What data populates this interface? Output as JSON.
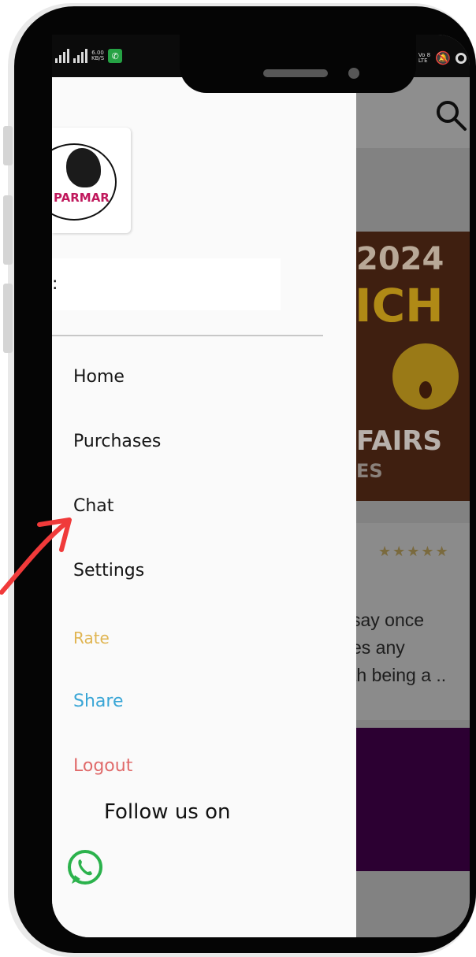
{
  "background_app": {
    "banner_year": "2024",
    "banner_big": "ICH",
    "banner_fairs": "FAIRS",
    "banner_es": "ES",
    "rating_stars": "★★★★★",
    "snippet_lines": [
      "say once",
      "es any",
      "th being a .."
    ]
  },
  "drawer": {
    "logo_text": "PARMAR",
    "name_colon": ":",
    "menu": [
      {
        "label": "Home"
      },
      {
        "label": "Purchases"
      },
      {
        "label": "Chat"
      },
      {
        "label": "Settings"
      },
      {
        "label": "Rate"
      },
      {
        "label": "Share"
      },
      {
        "label": "Logout"
      }
    ],
    "follow_label": "Follow us on"
  },
  "status_bar": {
    "speed": "6.00",
    "speed_unit": "KB/S",
    "volte": "Vo 8",
    "lte": "LTE"
  },
  "colors": {
    "rate": "#e0b552",
    "share": "#3aa6d6",
    "logout": "#e06a6a",
    "whatsapp": "#2bb24c",
    "annotation_arrow": "#f03a3a"
  },
  "icons": [
    "search-icon",
    "whatsapp-icon",
    "mute-icon",
    "signal-icon"
  ]
}
